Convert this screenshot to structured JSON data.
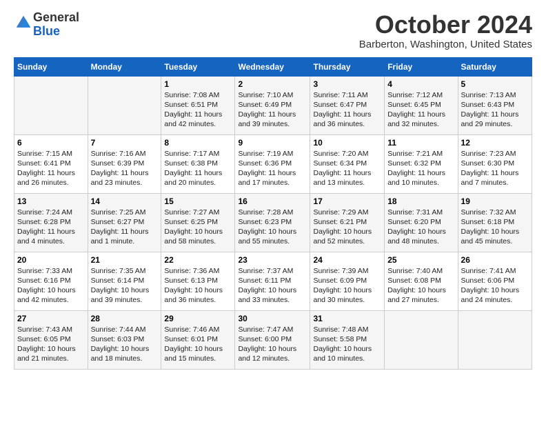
{
  "header": {
    "logo_line1": "General",
    "logo_line2": "Blue",
    "month": "October 2024",
    "location": "Barberton, Washington, United States"
  },
  "days_of_week": [
    "Sunday",
    "Monday",
    "Tuesday",
    "Wednesday",
    "Thursday",
    "Friday",
    "Saturday"
  ],
  "weeks": [
    [
      {
        "day": "",
        "info": ""
      },
      {
        "day": "",
        "info": ""
      },
      {
        "day": "1",
        "info": "Sunrise: 7:08 AM\nSunset: 6:51 PM\nDaylight: 11 hours and 42 minutes."
      },
      {
        "day": "2",
        "info": "Sunrise: 7:10 AM\nSunset: 6:49 PM\nDaylight: 11 hours and 39 minutes."
      },
      {
        "day": "3",
        "info": "Sunrise: 7:11 AM\nSunset: 6:47 PM\nDaylight: 11 hours and 36 minutes."
      },
      {
        "day": "4",
        "info": "Sunrise: 7:12 AM\nSunset: 6:45 PM\nDaylight: 11 hours and 32 minutes."
      },
      {
        "day": "5",
        "info": "Sunrise: 7:13 AM\nSunset: 6:43 PM\nDaylight: 11 hours and 29 minutes."
      }
    ],
    [
      {
        "day": "6",
        "info": "Sunrise: 7:15 AM\nSunset: 6:41 PM\nDaylight: 11 hours and 26 minutes."
      },
      {
        "day": "7",
        "info": "Sunrise: 7:16 AM\nSunset: 6:39 PM\nDaylight: 11 hours and 23 minutes."
      },
      {
        "day": "8",
        "info": "Sunrise: 7:17 AM\nSunset: 6:38 PM\nDaylight: 11 hours and 20 minutes."
      },
      {
        "day": "9",
        "info": "Sunrise: 7:19 AM\nSunset: 6:36 PM\nDaylight: 11 hours and 17 minutes."
      },
      {
        "day": "10",
        "info": "Sunrise: 7:20 AM\nSunset: 6:34 PM\nDaylight: 11 hours and 13 minutes."
      },
      {
        "day": "11",
        "info": "Sunrise: 7:21 AM\nSunset: 6:32 PM\nDaylight: 11 hours and 10 minutes."
      },
      {
        "day": "12",
        "info": "Sunrise: 7:23 AM\nSunset: 6:30 PM\nDaylight: 11 hours and 7 minutes."
      }
    ],
    [
      {
        "day": "13",
        "info": "Sunrise: 7:24 AM\nSunset: 6:28 PM\nDaylight: 11 hours and 4 minutes."
      },
      {
        "day": "14",
        "info": "Sunrise: 7:25 AM\nSunset: 6:27 PM\nDaylight: 11 hours and 1 minute."
      },
      {
        "day": "15",
        "info": "Sunrise: 7:27 AM\nSunset: 6:25 PM\nDaylight: 10 hours and 58 minutes."
      },
      {
        "day": "16",
        "info": "Sunrise: 7:28 AM\nSunset: 6:23 PM\nDaylight: 10 hours and 55 minutes."
      },
      {
        "day": "17",
        "info": "Sunrise: 7:29 AM\nSunset: 6:21 PM\nDaylight: 10 hours and 52 minutes."
      },
      {
        "day": "18",
        "info": "Sunrise: 7:31 AM\nSunset: 6:20 PM\nDaylight: 10 hours and 48 minutes."
      },
      {
        "day": "19",
        "info": "Sunrise: 7:32 AM\nSunset: 6:18 PM\nDaylight: 10 hours and 45 minutes."
      }
    ],
    [
      {
        "day": "20",
        "info": "Sunrise: 7:33 AM\nSunset: 6:16 PM\nDaylight: 10 hours and 42 minutes."
      },
      {
        "day": "21",
        "info": "Sunrise: 7:35 AM\nSunset: 6:14 PM\nDaylight: 10 hours and 39 minutes."
      },
      {
        "day": "22",
        "info": "Sunrise: 7:36 AM\nSunset: 6:13 PM\nDaylight: 10 hours and 36 minutes."
      },
      {
        "day": "23",
        "info": "Sunrise: 7:37 AM\nSunset: 6:11 PM\nDaylight: 10 hours and 33 minutes."
      },
      {
        "day": "24",
        "info": "Sunrise: 7:39 AM\nSunset: 6:09 PM\nDaylight: 10 hours and 30 minutes."
      },
      {
        "day": "25",
        "info": "Sunrise: 7:40 AM\nSunset: 6:08 PM\nDaylight: 10 hours and 27 minutes."
      },
      {
        "day": "26",
        "info": "Sunrise: 7:41 AM\nSunset: 6:06 PM\nDaylight: 10 hours and 24 minutes."
      }
    ],
    [
      {
        "day": "27",
        "info": "Sunrise: 7:43 AM\nSunset: 6:05 PM\nDaylight: 10 hours and 21 minutes."
      },
      {
        "day": "28",
        "info": "Sunrise: 7:44 AM\nSunset: 6:03 PM\nDaylight: 10 hours and 18 minutes."
      },
      {
        "day": "29",
        "info": "Sunrise: 7:46 AM\nSunset: 6:01 PM\nDaylight: 10 hours and 15 minutes."
      },
      {
        "day": "30",
        "info": "Sunrise: 7:47 AM\nSunset: 6:00 PM\nDaylight: 10 hours and 12 minutes."
      },
      {
        "day": "31",
        "info": "Sunrise: 7:48 AM\nSunset: 5:58 PM\nDaylight: 10 hours and 10 minutes."
      },
      {
        "day": "",
        "info": ""
      },
      {
        "day": "",
        "info": ""
      }
    ]
  ]
}
